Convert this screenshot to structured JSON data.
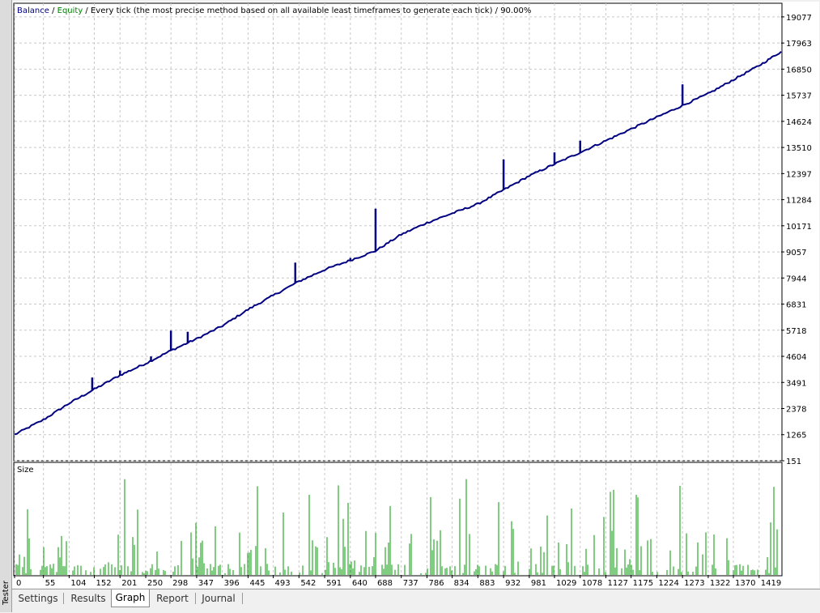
{
  "side_tab": {
    "label": "Tester"
  },
  "header": {
    "balance_label": "Balance",
    "sep1": " / ",
    "equity_label": "Equity",
    "rest": " / Every tick (the most precise method based on all available least timeframes to generate each tick) / 90.00%"
  },
  "colors": {
    "balance": "#000080",
    "equity": "#008000",
    "size_bars": "#009900",
    "grid": "#c8c8c8"
  },
  "chart_data": [
    {
      "type": "line",
      "ylim": [
        151,
        19660
      ],
      "y_tick_labels": [
        "19077",
        "17963",
        "16850",
        "15737",
        "14624",
        "13510",
        "12397",
        "11284",
        "10171",
        "9057",
        "7944",
        "6831",
        "5718",
        "4604",
        "3491",
        "2378",
        "1265",
        "151"
      ],
      "y_ticks": [
        19077,
        17963,
        16850,
        15737,
        14624,
        13510,
        12397,
        11284,
        10171,
        9057,
        7944,
        6831,
        5718,
        4604,
        3491,
        2378,
        1265,
        151
      ],
      "grid": true,
      "series": [
        {
          "name": "Balance",
          "color": "#000080",
          "points": [
            [
              0,
              1265
            ],
            [
              55,
              1900
            ],
            [
              104,
              2600
            ],
            [
              152,
              3200
            ],
            [
              201,
              3800
            ],
            [
              250,
              4300
            ],
            [
              298,
              4850
            ],
            [
              347,
              5350
            ],
            [
              396,
              5900
            ],
            [
              445,
              6600
            ],
            [
              493,
              7200
            ],
            [
              542,
              7800
            ],
            [
              591,
              8300
            ],
            [
              640,
              8700
            ],
            [
              688,
              9100
            ],
            [
              737,
              9800
            ],
            [
              786,
              10300
            ],
            [
              834,
              10700
            ],
            [
              883,
              11100
            ],
            [
              932,
              11700
            ],
            [
              981,
              12300
            ],
            [
              1029,
              12800
            ],
            [
              1078,
              13300
            ],
            [
              1127,
              13800
            ],
            [
              1175,
              14300
            ],
            [
              1224,
              14800
            ],
            [
              1273,
              15300
            ],
            [
              1322,
              15800
            ],
            [
              1370,
              16400
            ],
            [
              1419,
              17000
            ],
            [
              1461,
              17600
            ]
          ]
        },
        {
          "name": "Equity spikes",
          "color": "#000080",
          "spikes": [
            [
              148,
              3700
            ],
            [
              201,
              4000
            ],
            [
              260,
              4600
            ],
            [
              298,
              5700
            ],
            [
              330,
              5650
            ],
            [
              535,
              8600
            ],
            [
              640,
              8800
            ],
            [
              688,
              10900
            ],
            [
              932,
              13000
            ],
            [
              1029,
              13300
            ],
            [
              1078,
              13800
            ],
            [
              1273,
              16200
            ]
          ]
        }
      ]
    },
    {
      "type": "bar",
      "title": "Size",
      "x_tick_labels": [
        "0",
        "55",
        "104",
        "152",
        "201",
        "250",
        "298",
        "347",
        "396",
        "445",
        "493",
        "542",
        "591",
        "640",
        "688",
        "737",
        "786",
        "834",
        "883",
        "932",
        "981",
        "1029",
        "1078",
        "1127",
        "1175",
        "1224",
        "1273",
        "1322",
        "1370",
        "1419"
      ],
      "x_ticks": [
        0,
        55,
        104,
        152,
        201,
        250,
        298,
        347,
        396,
        445,
        493,
        542,
        591,
        640,
        688,
        737,
        786,
        834,
        883,
        932,
        981,
        1029,
        1078,
        1127,
        1175,
        1224,
        1273,
        1322,
        1370,
        1419
      ],
      "xlim": [
        0,
        1461
      ],
      "seed": 7
    }
  ],
  "tabs": [
    "Settings",
    "Results",
    "Graph",
    "Report",
    "Journal"
  ],
  "active_tab": "Graph"
}
